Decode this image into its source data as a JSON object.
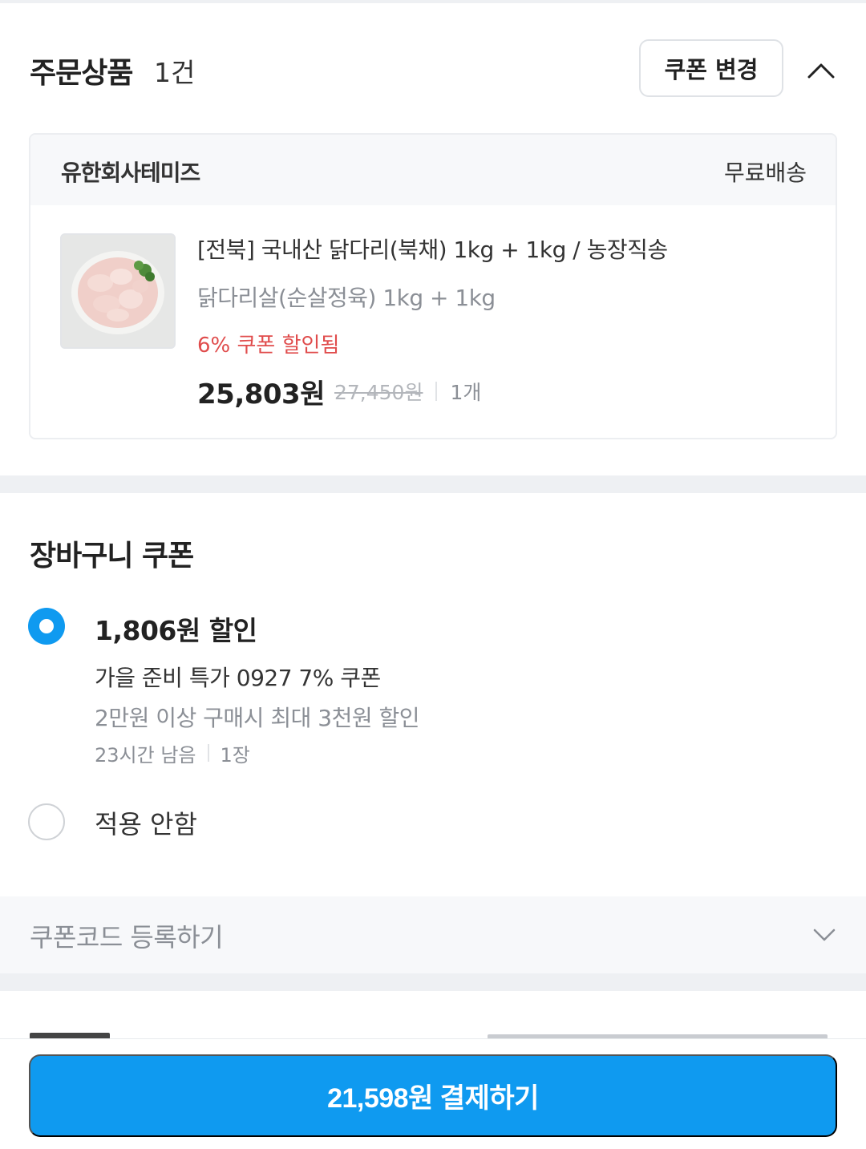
{
  "order": {
    "title": "주문상품",
    "count": "1건",
    "coupon_change_label": "쿠폰 변경",
    "collapse_icon": "chevron-up-icon"
  },
  "product_card": {
    "seller": "유한회사테미즈",
    "shipping": "무료배송",
    "thumbnail": "product-image",
    "name": "[전북] 국내산 닭다리(북채) 1kg + 1kg / 농장직송",
    "option": "닭다리살(순살정육) 1kg + 1kg",
    "discount_note": "6% 쿠폰 할인됨",
    "price": "25,803원",
    "original_price": "27,450원",
    "quantity": "1개"
  },
  "cart_coupon": {
    "title": "장바구니 쿠폰",
    "options": [
      {
        "selected": true,
        "amount": "1,806원 할인",
        "name": "가을 준비 특가 0927 7% 쿠폰",
        "condition": "2만원 이상 구매시 최대 3천원 할인",
        "remaining": "23시간 남음",
        "count": "1장"
      },
      {
        "selected": false,
        "label": "적용 안함"
      }
    ],
    "code_register_label": "쿠폰코드 등록하기",
    "code_chevron_icon": "chevron-down-icon"
  },
  "pay_button_label": "21,598원 결제하기",
  "colors": {
    "accent": "#0f9af0",
    "discount_red": "#e04c4c",
    "gap_gray": "#eef0f3"
  }
}
